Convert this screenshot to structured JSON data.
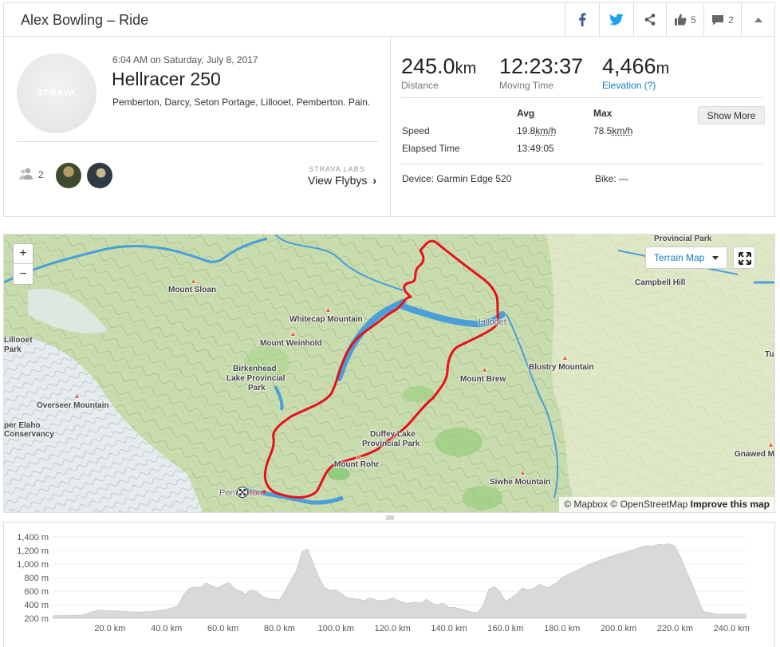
{
  "header": {
    "title": "Alex Bowling – Ride",
    "kudos_count": "5",
    "comment_count": "2"
  },
  "activity": {
    "date": "6:04 AM on Saturday, July 8, 2017",
    "name": "Hellracer 250",
    "description": "Pemberton, Darcy, Seton Portage, Lillooet, Pemberton. Pain.",
    "avatar_logo": "STRAVA",
    "athletes_count": "2",
    "flyby_label": "STRAVA LABS",
    "flyby_link": "View Flybys"
  },
  "stats": {
    "distance": {
      "value": "245.0",
      "unit": "km",
      "label": "Distance"
    },
    "moving_time": {
      "value": "12:23:37",
      "label": "Moving Time"
    },
    "elevation": {
      "value": "4,466",
      "unit": "m",
      "label": "Elevation (?)"
    },
    "avg_header": "Avg",
    "max_header": "Max",
    "speed_label": "Speed",
    "speed_avg": "19.8",
    "speed_max": "78.5",
    "speed_unit": "km/h",
    "elapsed_label": "Elapsed Time",
    "elapsed_avg": "13:49:05",
    "show_more": "Show More",
    "device": "Device: Garmin Edge 520",
    "bike": "Bike: —"
  },
  "map": {
    "zoom_in": "+",
    "zoom_out": "−",
    "style_button": "Terrain Map",
    "labels": {
      "provincial_park": "Provincial Park",
      "campbell_hill": "Campbell Hill",
      "mount_sloan": "Mount Sloan",
      "whitecap_mountain": "Whitecap Mountain",
      "lillooet": "Lillooet",
      "mount_weinhold": "Mount Weinhold",
      "birkenhead_1": "Birkenhead",
      "birkenhead_2": "Lake Provincial",
      "birkenhead_3": "Park",
      "blustry_mountain": "Blustry Mountain",
      "mount_brew": "Mount Brew",
      "lillooet_park_1": "Lillooet",
      "lillooet_park_2": "Park",
      "overseer_mountain": "Overseer Mountain",
      "elaho_1": "per Elaho",
      "elaho_2": "Conservancy",
      "duffey_1": "Duffey Lake",
      "duffey_2": "Provincial Park",
      "mount_rohr": "Mount Rohr",
      "gnawed_m": "Gnawed M",
      "siwhe_mountain": "Siwhe Mountain",
      "pemberton": "Pemberton",
      "tu": "Tu"
    },
    "attribution_mapbox": "© Mapbox",
    "attribution_osm": "© OpenStreetMap",
    "attribution_improve": "Improve this map",
    "colors": {
      "route": "#e8101c",
      "water": "#4a9fd8"
    }
  },
  "chart_data": {
    "type": "area",
    "title": "",
    "xlabel": "",
    "ylabel": "",
    "x_ticks": [
      "20.0 km",
      "40.0 km",
      "60.0 km",
      "80.0 km",
      "100.0 km",
      "120.0 km",
      "140.0 km",
      "160.0 km",
      "180.0 km",
      "200.0 km",
      "220.0 km",
      "240.0 km"
    ],
    "y_ticks": [
      "200 m",
      "400 m",
      "600 m",
      "800 m",
      "1,000 m",
      "1,200 m",
      "1,400 m"
    ],
    "xlim": [
      0,
      245
    ],
    "ylim": [
      200,
      1400
    ],
    "fill_color": "#d9d9d9",
    "series": [
      {
        "x": [
          0,
          5,
          10,
          12,
          14,
          16,
          20,
          25,
          30,
          35,
          40,
          44,
          46,
          48,
          50,
          52,
          54,
          56,
          58,
          60,
          62,
          64,
          66,
          68,
          70,
          72,
          74,
          76,
          78,
          80,
          82,
          84,
          86,
          88,
          90,
          92,
          94,
          96,
          98,
          100,
          102,
          104,
          106,
          108,
          110,
          112,
          115,
          118,
          120,
          122,
          125,
          128,
          130,
          132,
          135,
          138,
          140,
          142,
          145,
          148,
          150,
          152,
          154,
          156,
          158,
          160,
          162,
          164,
          166,
          168,
          170,
          172,
          175,
          178,
          180,
          185,
          190,
          195,
          200,
          203,
          206,
          208,
          210,
          212,
          214,
          216,
          218,
          220,
          222,
          224,
          226,
          228,
          230,
          235,
          240,
          245
        ],
        "y": [
          240,
          240,
          245,
          270,
          300,
          320,
          310,
          300,
          290,
          300,
          330,
          380,
          540,
          640,
          660,
          650,
          720,
          680,
          650,
          690,
          730,
          640,
          600,
          560,
          620,
          590,
          520,
          490,
          480,
          470,
          600,
          760,
          900,
          1180,
          1220,
          1000,
          800,
          650,
          610,
          620,
          560,
          500,
          490,
          480,
          460,
          500,
          460,
          470,
          500,
          460,
          420,
          440,
          420,
          480,
          400,
          420,
          360,
          360,
          330,
          290,
          280,
          380,
          620,
          670,
          590,
          450,
          500,
          560,
          650,
          620,
          640,
          700,
          650,
          720,
          800,
          900,
          1000,
          1080,
          1150,
          1180,
          1220,
          1250,
          1270,
          1260,
          1290,
          1280,
          1300,
          1260,
          1100,
          900,
          700,
          500,
          300,
          260,
          260,
          260
        ]
      }
    ]
  }
}
